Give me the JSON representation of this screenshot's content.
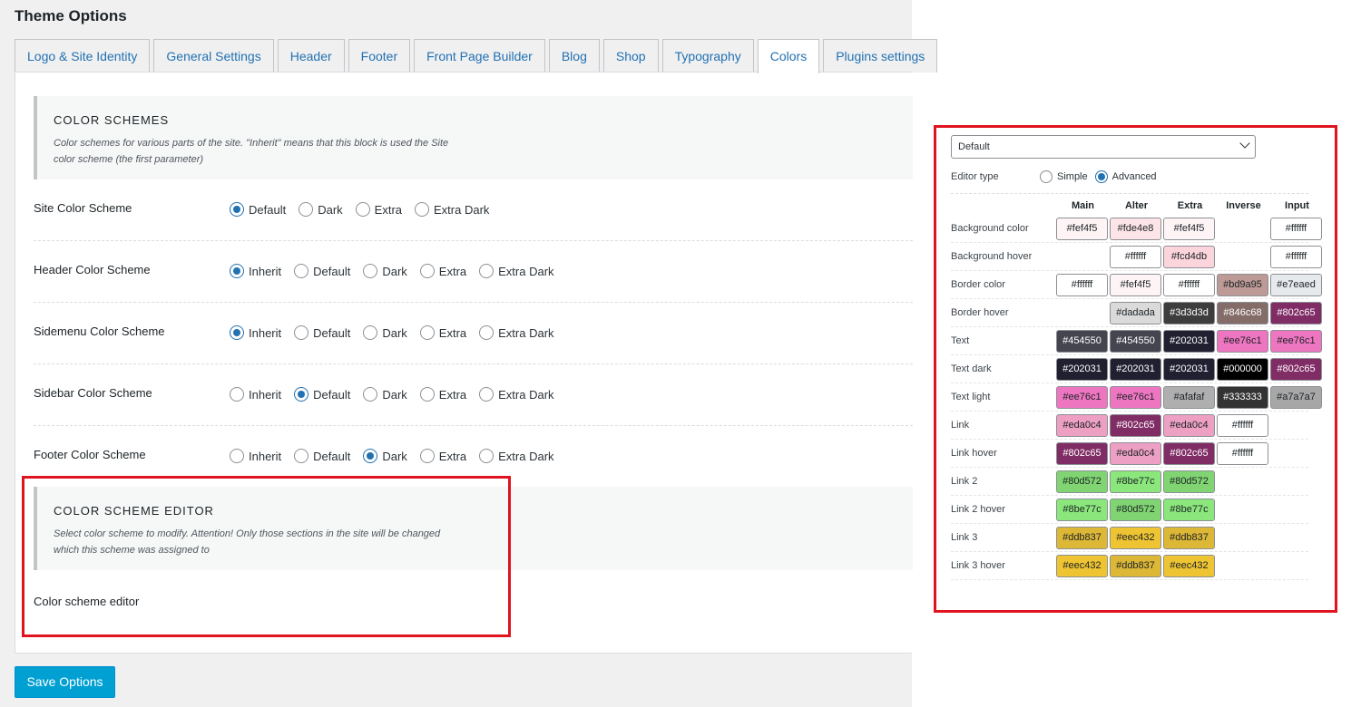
{
  "page_title": "Theme Options",
  "tabs": [
    {
      "label": "Logo & Site Identity",
      "active": false
    },
    {
      "label": "General Settings",
      "active": false
    },
    {
      "label": "Header",
      "active": false
    },
    {
      "label": "Footer",
      "active": false
    },
    {
      "label": "Front Page Builder",
      "active": false
    },
    {
      "label": "Blog",
      "active": false
    },
    {
      "label": "Shop",
      "active": false
    },
    {
      "label": "Typography",
      "active": false
    },
    {
      "label": "Colors",
      "active": true
    },
    {
      "label": "Plugins settings",
      "active": false
    }
  ],
  "color_schemes_section": {
    "title": "COLOR SCHEMES",
    "description": "Color schemes for various parts of the site. \"Inherit\" means that this block is used the Site color scheme (the first parameter)"
  },
  "scheme_rows": [
    {
      "label": "Site Color Scheme",
      "options": [
        "Default",
        "Dark",
        "Extra",
        "Extra Dark"
      ],
      "selected": "Default"
    },
    {
      "label": "Header Color Scheme",
      "options": [
        "Inherit",
        "Default",
        "Dark",
        "Extra",
        "Extra Dark"
      ],
      "selected": "Inherit"
    },
    {
      "label": "Sidemenu Color Scheme",
      "options": [
        "Inherit",
        "Default",
        "Dark",
        "Extra",
        "Extra Dark"
      ],
      "selected": "Inherit"
    },
    {
      "label": "Sidebar Color Scheme",
      "options": [
        "Inherit",
        "Default",
        "Dark",
        "Extra",
        "Extra Dark"
      ],
      "selected": "Default"
    },
    {
      "label": "Footer Color Scheme",
      "options": [
        "Inherit",
        "Default",
        "Dark",
        "Extra",
        "Extra Dark"
      ],
      "selected": "Dark"
    }
  ],
  "editor_section": {
    "title": "COLOR SCHEME EDITOR",
    "description": "Select color scheme to modify. Attention! Only those sections in the site will be changed which this scheme was assigned to",
    "field_label": "Color scheme editor"
  },
  "save_button": "Save Options",
  "highlight_color": "#e0141e",
  "editor_panel": {
    "selected_scheme": "Default",
    "editor_type_label": "Editor type",
    "editor_type_options": [
      "Simple",
      "Advanced"
    ],
    "editor_type_selected": "Advanced",
    "columns": [
      "Main",
      "Alter",
      "Extra",
      "Inverse",
      "Input"
    ],
    "rows": [
      {
        "label": "Background color",
        "values": [
          "#fef4f5",
          "#fde4e8",
          "#fef4f5",
          "",
          "#ffffff"
        ]
      },
      {
        "label": "Background hover",
        "values": [
          "",
          "#ffffff",
          "#fcd4db",
          "",
          "#ffffff"
        ]
      },
      {
        "label": "Border color",
        "values": [
          "#ffffff",
          "#fef4f5",
          "#ffffff",
          "#bd9a95",
          "#e7eaed"
        ]
      },
      {
        "label": "Border hover",
        "values": [
          "",
          "#dadada",
          "#3d3d3d",
          "#846c68",
          "#802c65"
        ]
      },
      {
        "label": "Text",
        "values": [
          "#454550",
          "#454550",
          "#202031",
          "#ee76c1",
          "#ee76c1"
        ]
      },
      {
        "label": "Text dark",
        "values": [
          "#202031",
          "#202031",
          "#202031",
          "#000000",
          "#802c65"
        ]
      },
      {
        "label": "Text light",
        "values": [
          "#ee76c1",
          "#ee76c1",
          "#afafaf",
          "#333333",
          "#a7a7a7"
        ]
      },
      {
        "label": "Link",
        "values": [
          "#eda0c4",
          "#802c65",
          "#eda0c4",
          "#ffffff",
          ""
        ]
      },
      {
        "label": "Link hover",
        "values": [
          "#802c65",
          "#eda0c4",
          "#802c65",
          "#ffffff",
          ""
        ]
      },
      {
        "label": "Link 2",
        "values": [
          "#80d572",
          "#8be77c",
          "#80d572",
          "",
          ""
        ]
      },
      {
        "label": "Link 2 hover",
        "values": [
          "#8be77c",
          "#80d572",
          "#8be77c",
          "",
          ""
        ]
      },
      {
        "label": "Link 3",
        "values": [
          "#ddb837",
          "#eec432",
          "#ddb837",
          "",
          ""
        ]
      },
      {
        "label": "Link 3 hover",
        "values": [
          "#eec432",
          "#ddb837",
          "#eec432",
          "",
          ""
        ]
      }
    ]
  }
}
